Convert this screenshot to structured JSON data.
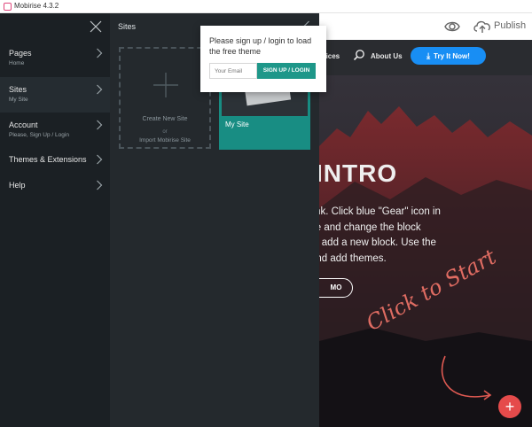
{
  "window": {
    "title": "Mobirise 4.3.2"
  },
  "toolbar": {
    "preview_icon": "eye-icon",
    "publish_icon": "cloud-upload-icon",
    "publish_label": "Publish"
  },
  "sidebar": {
    "close_icon": "close-icon",
    "items": [
      {
        "label": "Pages",
        "sub": "Home"
      },
      {
        "label": "Sites",
        "sub": "My Site"
      },
      {
        "label": "Account",
        "sub": "Please, Sign Up / Login"
      },
      {
        "label": "Themes & Extensions",
        "sub": ""
      },
      {
        "label": "Help",
        "sub": ""
      }
    ]
  },
  "sites_panel": {
    "title": "Sites",
    "create": {
      "label": "Create New Site",
      "or": "or",
      "import": "Import Mobirise Site"
    },
    "site": {
      "label": "My Site"
    }
  },
  "popup": {
    "message": "Please sign up / login to load the free theme",
    "email_placeholder": "Your Email",
    "signup_label": "SIGN UP / LOGIN"
  },
  "preview": {
    "nav": {
      "services": "rvices",
      "about": "About Us",
      "try": "Try It Now!"
    },
    "hero_title": "INTRO",
    "hero_lines": [
      "link. Click blue \"Gear\" icon in",
      "tle and change the block",
      "to add a new block. Use the",
      "and add themes."
    ],
    "demo_label": "MO",
    "click_start": "Click to Start",
    "fab_label": "+"
  },
  "colors": {
    "sidebar_bg": "#1b2024",
    "panel_bg": "#24292d",
    "teal": "#1e9789",
    "try_blue": "#188ef4",
    "fab_red": "#e54b4b"
  }
}
